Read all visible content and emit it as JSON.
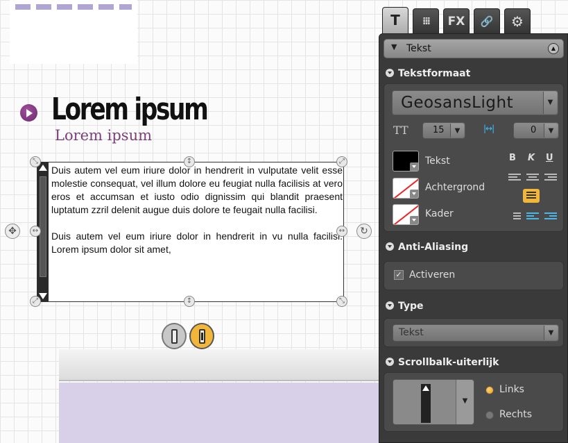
{
  "canvas": {
    "heading": "Lorem ipsum",
    "subheading": "Lorem ipsum",
    "paragraphs": [
      "Duis autem vel eum iriure dolor in hendrerit in vulputate velit esse molestie consequat, vel illum dolore eu feugiat nulla facilisis at vero eros et accumsan et iusto odio dignissim qui blandit praesent luptatum zzril delenit augue duis dolore te feugait nulla facilisi.",
      "Duis autem vel eum iriure dolor in hendrerit in vu nulla facilisi. Lorem ipsum dolor sit amet,"
    ]
  },
  "tabs": [
    {
      "label": "T",
      "icon": "text-icon"
    },
    {
      "label": "⁞⁞⁞",
      "icon": "grid-icon"
    },
    {
      "label": "FX",
      "icon": "fx-icon"
    },
    {
      "label": "🔗",
      "icon": "link-icon"
    },
    {
      "label": "⚙",
      "icon": "gears-icon"
    }
  ],
  "panel": {
    "header": "Tekst",
    "sections": {
      "format": "Tekstformaat",
      "antialias": "Anti-Aliasing",
      "type": "Type",
      "scrollbar": "Scrollbalk-uiterlijk"
    },
    "font": "GeosansLight",
    "size_icon": "TT",
    "font_size": "15",
    "spacing": "0",
    "colors": {
      "text": "Tekst",
      "background": "Achtergrond",
      "border": "Kader"
    },
    "format_buttons": {
      "bold": "B",
      "italic": "K",
      "underline": "U"
    },
    "antialias_label": "Activeren",
    "antialias_checked": "✓",
    "type_value": "Tekst",
    "scroll_options": {
      "left": "Links",
      "right": "Rechts"
    },
    "accent": "#f2b73a"
  }
}
